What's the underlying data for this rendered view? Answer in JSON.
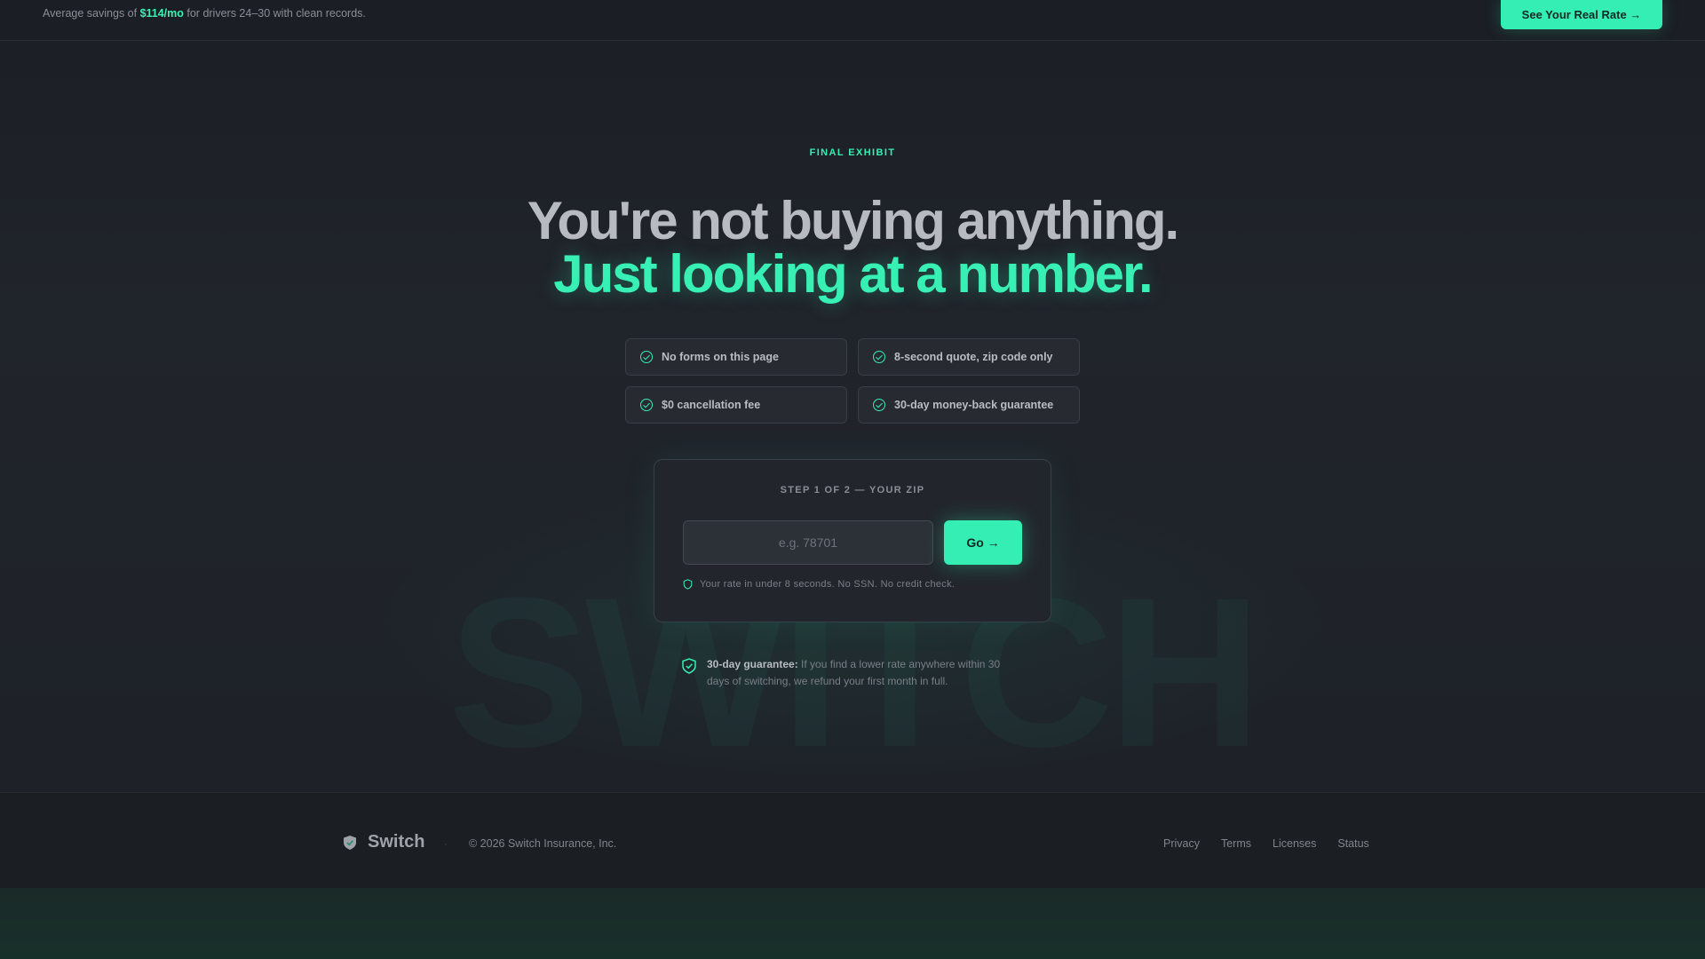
{
  "topbar": {
    "prefix": "Average savings of ",
    "highlight": "$114/mo",
    "suffix": " for drivers 24–30 with clean records.",
    "cta_label": "See Your Real Rate →"
  },
  "hero": {
    "eyebrow": "FINAL EXHIBIT",
    "headline_line1": "You're not buying anything.",
    "headline_line2": "Just looking at a number.",
    "watermark": "SWITCH",
    "features": [
      {
        "label": "No forms on this page"
      },
      {
        "label": "8-second quote, zip code only"
      },
      {
        "label": "$0 cancellation fee"
      },
      {
        "label": "30-day money-back guarantee"
      }
    ]
  },
  "quote_card": {
    "step_label": "STEP 1 OF 2 — YOUR ZIP",
    "zip_placeholder": "e.g. 78701",
    "zip_value": "",
    "go_label": "Go →",
    "note": "Your rate in under 8 seconds. No SSN. No credit check."
  },
  "guarantee": {
    "lead": "30-day guarantee:",
    "body": " If you find a lower rate anywhere within 30 days of switching, we refund your first month in full."
  },
  "footer": {
    "brand": "Switch",
    "separator": "·",
    "copyright": "© 2026 Switch Insurance, Inc.",
    "links": [
      {
        "label": "Privacy"
      },
      {
        "label": "Terms"
      },
      {
        "label": "Licenses"
      },
      {
        "label": "Status"
      }
    ]
  },
  "colors": {
    "accent": "#35eeb3",
    "background": "#1c1f25",
    "card": "#22262c"
  }
}
